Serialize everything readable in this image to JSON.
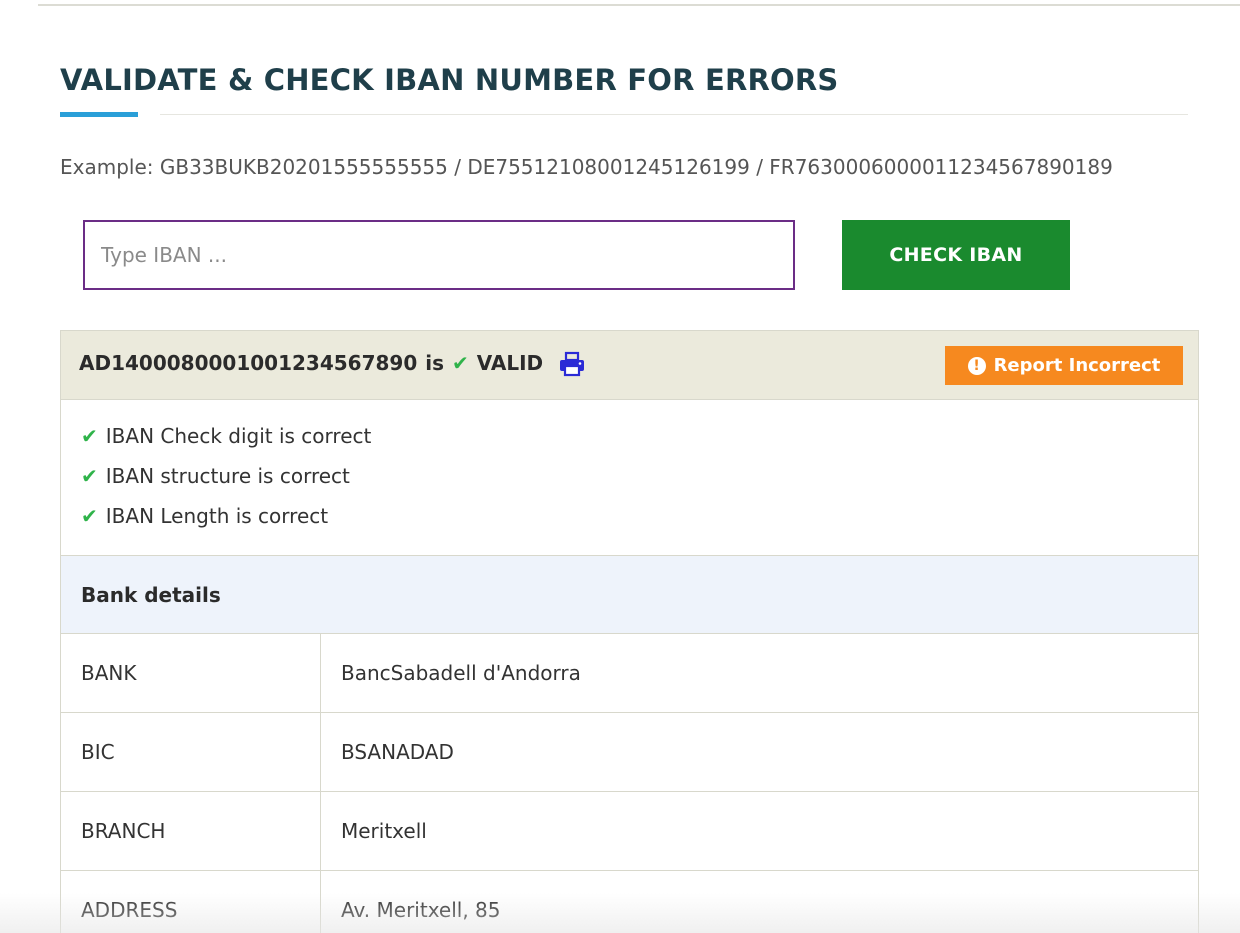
{
  "header": {
    "title": "VALIDATE & CHECK IBAN NUMBER FOR ERRORS"
  },
  "example": {
    "text": "Example: GB33BUKB20201555555555 / DE75512108001245126199 / FR7630006000011234567890189"
  },
  "form": {
    "input_placeholder": "Type IBAN ...",
    "input_value": "",
    "submit_label": "CHECK IBAN"
  },
  "result": {
    "iban": "AD1400080001001234567890",
    "connector": "is",
    "status": "VALID",
    "status_icon": "checkmark-icon",
    "print_icon": "print-icon",
    "report_label": "Report Incorrect",
    "report_icon": "exclamation-circle-icon",
    "colors": {
      "header_bg": "#ebeadc",
      "valid_check": "#2fb34a",
      "report_btn": "#f6891f",
      "print_icon": "#2b2bd6"
    }
  },
  "checks": [
    {
      "label": "IBAN Check digit is correct"
    },
    {
      "label": "IBAN structure is correct"
    },
    {
      "label": "IBAN Length is correct"
    }
  ],
  "bank_details": {
    "heading": "Bank details",
    "rows": [
      {
        "key": "BANK",
        "value": "BancSabadell d'Andorra"
      },
      {
        "key": "BIC",
        "value": "BSANADAD"
      },
      {
        "key": "BRANCH",
        "value": "Meritxell"
      },
      {
        "key": "ADDRESS",
        "value": "Av. Meritxell, 85"
      }
    ]
  },
  "theme": {
    "title_color": "#1f3f4a",
    "accent_blue": "#2a9fd8",
    "primary_button": "#1a8a2e",
    "input_border": "#6b2d86"
  }
}
